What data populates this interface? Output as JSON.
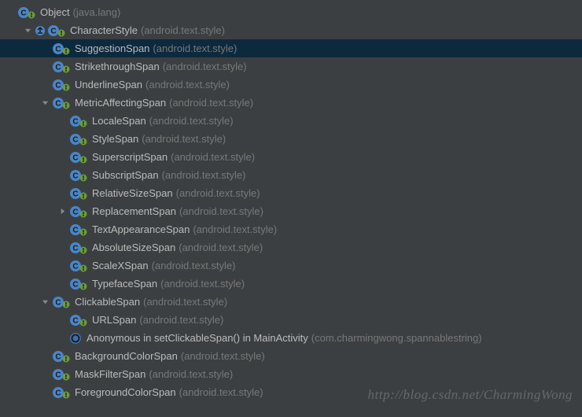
{
  "watermark": "http://blog.csdn.net/CharmingWong",
  "indentUnit": 22,
  "rows": [
    {
      "indent": 0,
      "arrow": "none",
      "icon": "class",
      "overlay": "green",
      "name": "Object",
      "pkg": "(java.lang)",
      "selected": false
    },
    {
      "indent": 1,
      "arrow": "down",
      "icon": "class",
      "overlay": "green",
      "preIcon": "override",
      "name": "CharacterStyle",
      "pkg": "(android.text.style)",
      "selected": false
    },
    {
      "indent": 2,
      "arrow": "none",
      "icon": "class",
      "overlay": "green",
      "name": "SuggestionSpan",
      "pkg": "(android.text.style)",
      "selected": true
    },
    {
      "indent": 2,
      "arrow": "none",
      "icon": "class",
      "overlay": "green",
      "name": "StrikethroughSpan",
      "pkg": "(android.text.style)",
      "selected": false
    },
    {
      "indent": 2,
      "arrow": "none",
      "icon": "class",
      "overlay": "green",
      "name": "UnderlineSpan",
      "pkg": "(android.text.style)",
      "selected": false
    },
    {
      "indent": 2,
      "arrow": "down",
      "icon": "class",
      "overlay": "green",
      "name": "MetricAffectingSpan",
      "pkg": "(android.text.style)",
      "selected": false
    },
    {
      "indent": 3,
      "arrow": "none",
      "icon": "class",
      "overlay": "green",
      "name": "LocaleSpan",
      "pkg": "(android.text.style)",
      "selected": false
    },
    {
      "indent": 3,
      "arrow": "none",
      "icon": "class",
      "overlay": "green",
      "name": "StyleSpan",
      "pkg": "(android.text.style)",
      "selected": false
    },
    {
      "indent": 3,
      "arrow": "none",
      "icon": "class",
      "overlay": "green",
      "name": "SuperscriptSpan",
      "pkg": "(android.text.style)",
      "selected": false
    },
    {
      "indent": 3,
      "arrow": "none",
      "icon": "class",
      "overlay": "green",
      "name": "SubscriptSpan",
      "pkg": "(android.text.style)",
      "selected": false
    },
    {
      "indent": 3,
      "arrow": "none",
      "icon": "class",
      "overlay": "green",
      "name": "RelativeSizeSpan",
      "pkg": "(android.text.style)",
      "selected": false
    },
    {
      "indent": 3,
      "arrow": "right",
      "icon": "class",
      "overlay": "green",
      "name": "ReplacementSpan",
      "pkg": "(android.text.style)",
      "selected": false
    },
    {
      "indent": 3,
      "arrow": "none",
      "icon": "class",
      "overlay": "green",
      "name": "TextAppearanceSpan",
      "pkg": "(android.text.style)",
      "selected": false
    },
    {
      "indent": 3,
      "arrow": "none",
      "icon": "class",
      "overlay": "green",
      "name": "AbsoluteSizeSpan",
      "pkg": "(android.text.style)",
      "selected": false
    },
    {
      "indent": 3,
      "arrow": "none",
      "icon": "class",
      "overlay": "green",
      "name": "ScaleXSpan",
      "pkg": "(android.text.style)",
      "selected": false
    },
    {
      "indent": 3,
      "arrow": "none",
      "icon": "class",
      "overlay": "green",
      "name": "TypefaceSpan",
      "pkg": "(android.text.style)",
      "selected": false
    },
    {
      "indent": 2,
      "arrow": "down",
      "icon": "class",
      "overlay": "green",
      "name": "ClickableSpan",
      "pkg": "(android.text.style)",
      "selected": false
    },
    {
      "indent": 3,
      "arrow": "none",
      "icon": "class",
      "overlay": "green",
      "name": "URLSpan",
      "pkg": "(android.text.style)",
      "selected": false
    },
    {
      "indent": 3,
      "arrow": "none",
      "icon": "anon",
      "overlay": "none",
      "name": "Anonymous in setClickableSpan() in MainActivity",
      "pkg": "(com.charmingwong.spannablestring)",
      "selected": false
    },
    {
      "indent": 2,
      "arrow": "none",
      "icon": "class",
      "overlay": "green",
      "name": "BackgroundColorSpan",
      "pkg": "(android.text.style)",
      "selected": false
    },
    {
      "indent": 2,
      "arrow": "none",
      "icon": "class",
      "overlay": "green",
      "name": "MaskFilterSpan",
      "pkg": "(android.text.style)",
      "selected": false
    },
    {
      "indent": 2,
      "arrow": "none",
      "icon": "class",
      "overlay": "green",
      "name": "ForegroundColorSpan",
      "pkg": "(android.text.style)",
      "selected": false
    }
  ]
}
